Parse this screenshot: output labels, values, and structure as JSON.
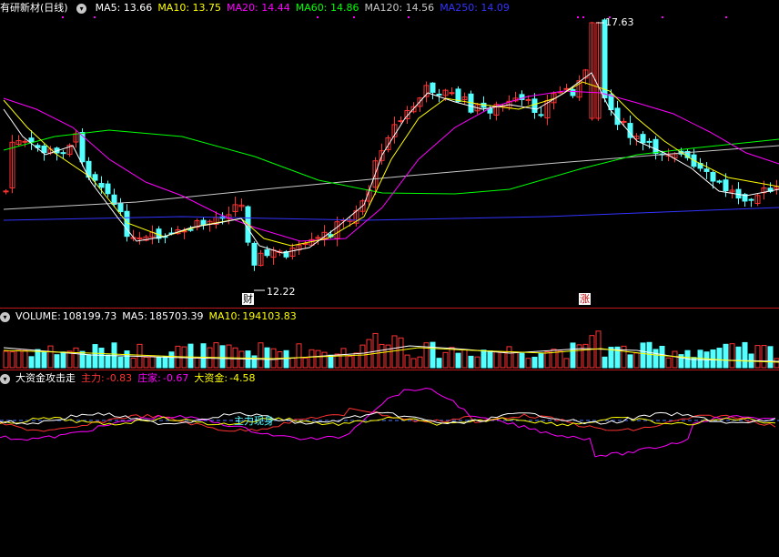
{
  "main_panel": {
    "title": "有研新材(日线)",
    "toggle_icon": "chevron-down-icon",
    "ma": [
      {
        "label": "MA5:",
        "value": "13.66",
        "color": "#ffffff"
      },
      {
        "label": "MA10:",
        "value": "13.75",
        "color": "#ffff00"
      },
      {
        "label": "MA20:",
        "value": "14.44",
        "color": "#ff00ff"
      },
      {
        "label": "MA60:",
        "value": "14.86",
        "color": "#00ff00"
      },
      {
        "label": "MA120:",
        "value": "14.56",
        "color": "#c8c8c8"
      },
      {
        "label": "MA250:",
        "value": "14.09",
        "color": "#3333ff"
      }
    ],
    "high_label": "17.63",
    "low_label": "12.22",
    "badge_cai": "财",
    "badge_zhang": "涨"
  },
  "volume_panel": {
    "label": "VOLUME:",
    "value": "108199.73",
    "ma5_label": "MA5:",
    "ma5_value": "185703.39",
    "ma10_label": "MA10:",
    "ma10_value": "194103.83"
  },
  "indicator_panel": {
    "title": "大资金攻击走",
    "zhuli_label": "主力:",
    "zhuli_value": "-0.83",
    "zhuangjia_label": "庄家:",
    "zhuangjia_value": "-0.67",
    "dazijin_label": "大资金:",
    "dazijin_value": "-4.58",
    "annotation": "主力现身"
  },
  "colors": {
    "up": "#ff3232",
    "down": "#54ffff",
    "ma5": "#ffffff",
    "ma10": "#ffff00",
    "ma20": "#ff00ff",
    "ma60": "#00ff00",
    "ma120": "#c8c8c8",
    "ma250": "#3333ff",
    "zhuli": "#ff3232",
    "zhuangjia": "#ff00ff",
    "dazijin": "#ffff00"
  }
}
